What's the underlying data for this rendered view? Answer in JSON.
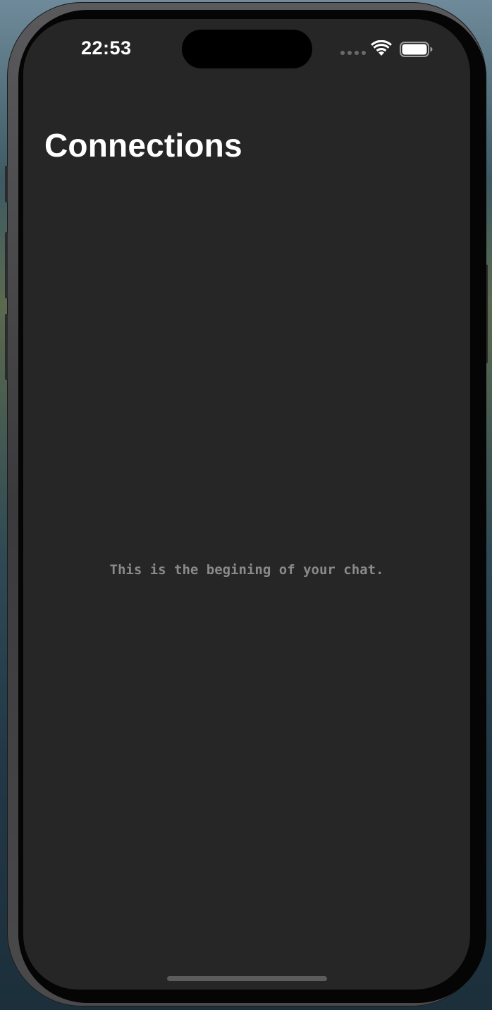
{
  "status_bar": {
    "time": "22:53",
    "icons": [
      "cellular-dots-icon",
      "wifi-icon",
      "battery-icon"
    ]
  },
  "header": {
    "title": "Connections"
  },
  "chat": {
    "empty_message": "This is the begining of your chat."
  },
  "colors": {
    "screen_background": "#262626",
    "title_text": "#ffffff",
    "muted_text": "#8a8a8a",
    "home_indicator": "#5c5c5c"
  }
}
